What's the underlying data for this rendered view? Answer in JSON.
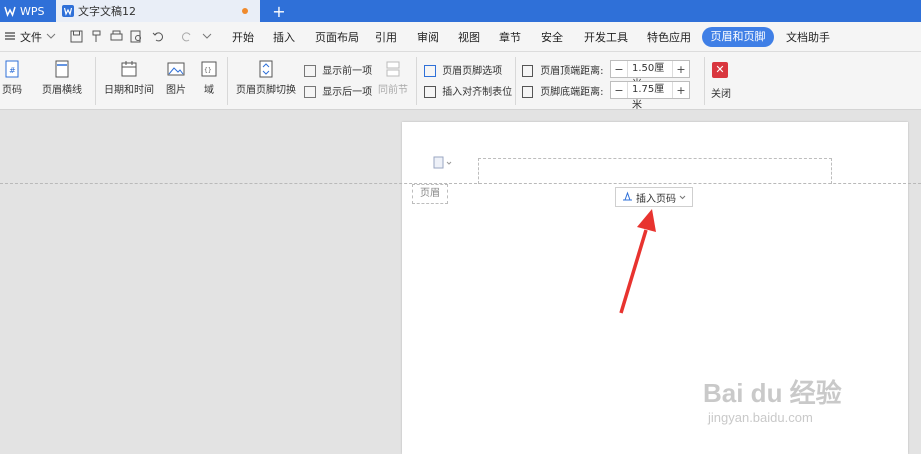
{
  "titlebar": {
    "app_tab": "WPS",
    "doc_tab": "文字文稿12",
    "add_tab": "+"
  },
  "menubar": {
    "file": "文件",
    "items": [
      "开始",
      "插入",
      "页面布局",
      "引用",
      "审阅",
      "视图",
      "章节",
      "安全",
      "开发工具",
      "特色应用"
    ],
    "active": "页眉和页脚",
    "after": "文档助手"
  },
  "ribbon": {
    "page_number": "页码",
    "header_line": "页眉横线",
    "date_time": "日期和时间",
    "picture": "图片",
    "field": "域",
    "switch": "页眉页脚切换",
    "show_prev": "显示前一项",
    "show_next": "显示后一项",
    "same_prev": "同前节",
    "options": "页眉页脚选项",
    "align_tab": "插入对齐制表位",
    "top_distance_label": "页眉顶端距离:",
    "top_distance_value": "1.50厘米",
    "bottom_distance_label": "页脚底端距离:",
    "bottom_distance_value": "1.75厘米",
    "minus": "−",
    "plus": "+",
    "close": "关闭"
  },
  "document": {
    "header_label": "页眉",
    "insert_page_number": "插入页码"
  },
  "watermark": {
    "line1": "Bai du 经验",
    "line2": "jingyan.baidu.com"
  },
  "colors": {
    "titlebar": "#2f70d8",
    "accent": "#3f7fe6",
    "arrow": "#e8332f",
    "close": "#d9363e"
  }
}
